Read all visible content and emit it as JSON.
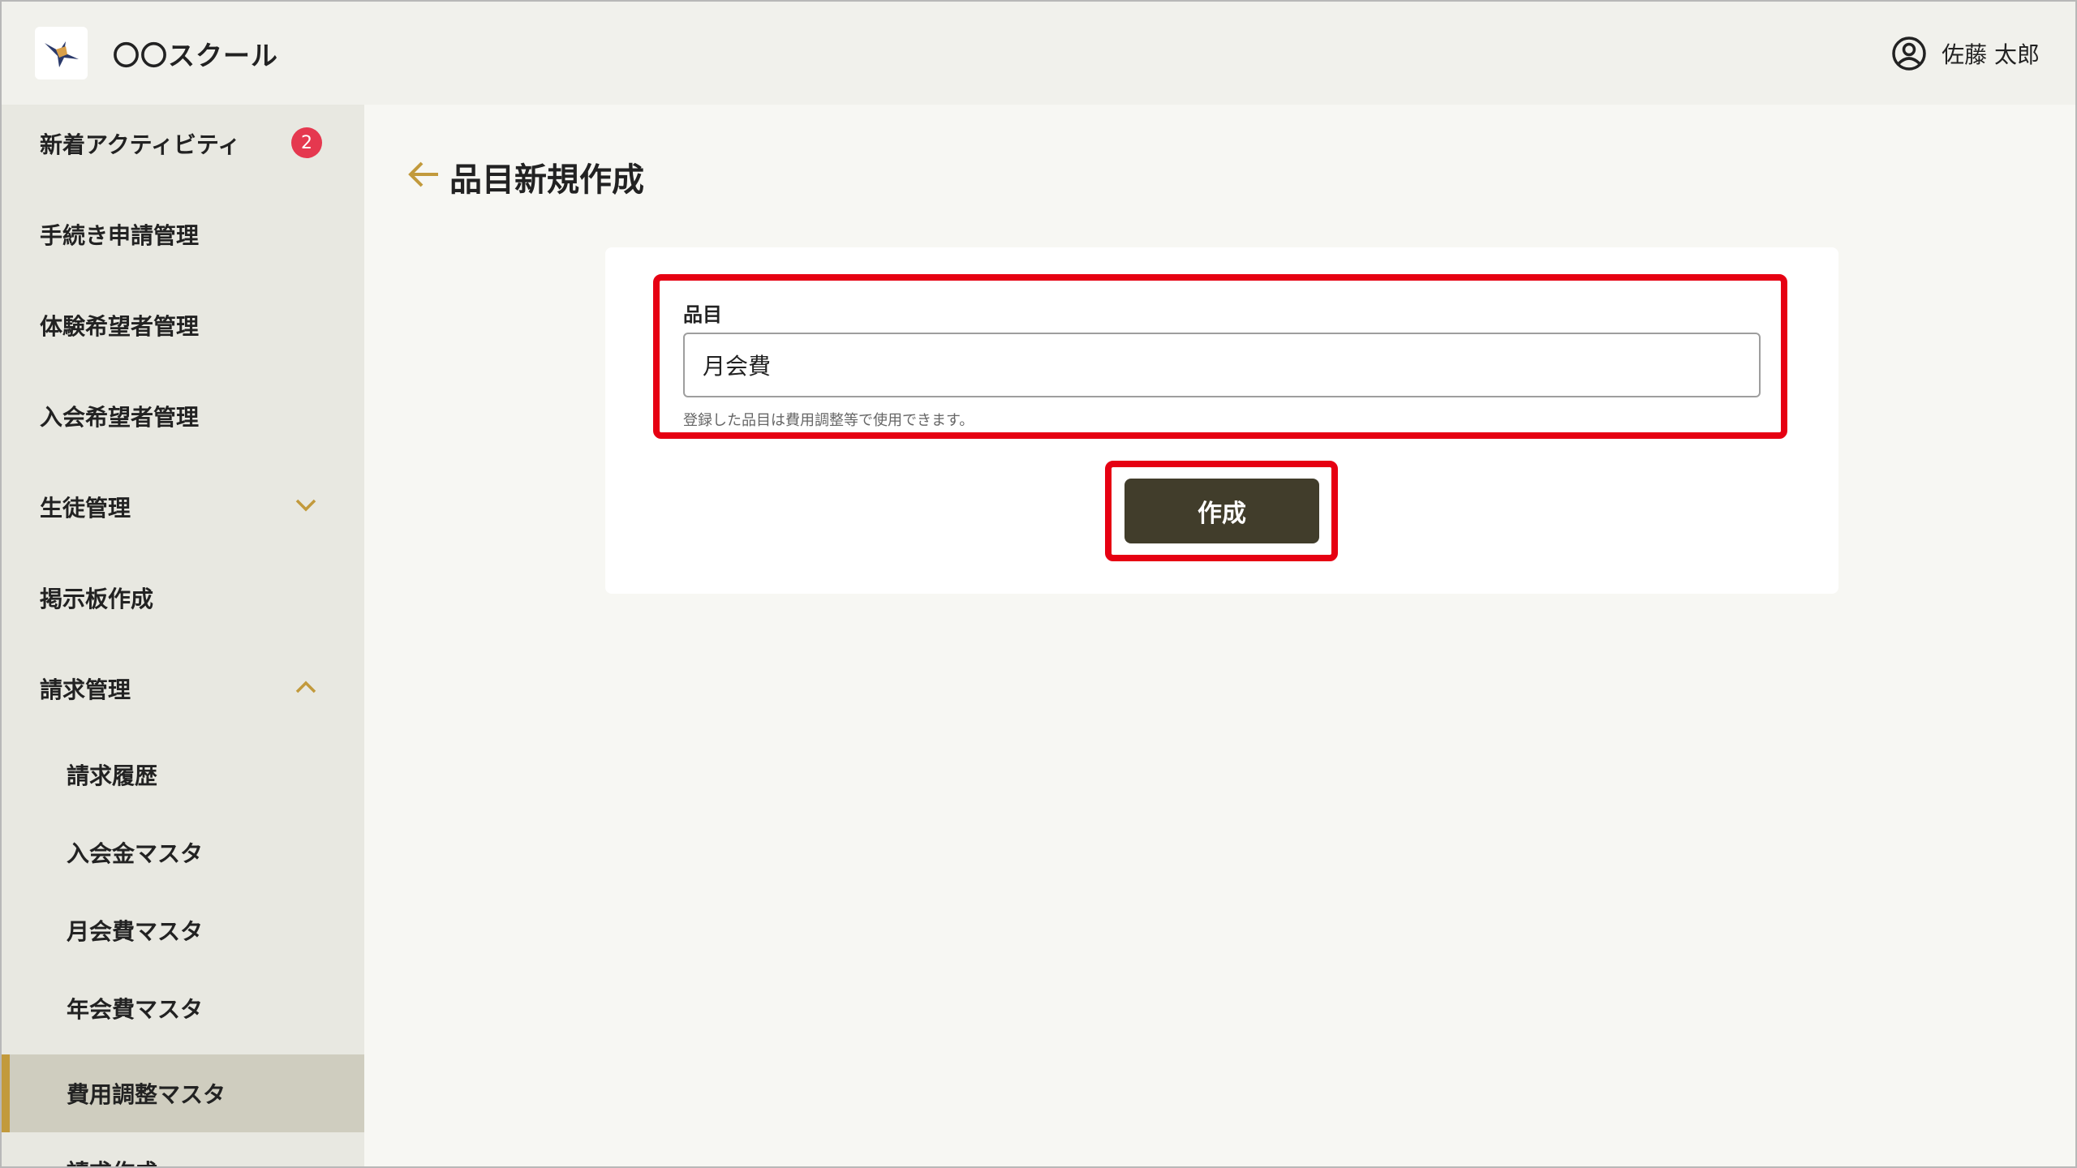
{
  "header": {
    "app_title": "〇〇スクール",
    "user_name": "佐藤 太郎"
  },
  "sidebar": {
    "items": [
      {
        "label": "新着アクティビティ",
        "badge": "2"
      },
      {
        "label": "手続き申請管理"
      },
      {
        "label": "体験希望者管理"
      },
      {
        "label": "入会希望者管理"
      },
      {
        "label": "生徒管理",
        "expanded": false
      },
      {
        "label": "掲示板作成"
      },
      {
        "label": "請求管理",
        "expanded": true
      }
    ],
    "billing_subitems": [
      {
        "label": "請求履歴"
      },
      {
        "label": "入会金マスタ"
      },
      {
        "label": "月会費マスタ"
      },
      {
        "label": "年会費マスタ"
      },
      {
        "label": "費用調整マスタ",
        "active": true
      },
      {
        "label": "請求作成"
      }
    ]
  },
  "main": {
    "page_title": "品目新規作成",
    "form": {
      "field_label": "品目",
      "field_value": "月会費",
      "help_text": "登録した品目は費用調整等で使用できます。",
      "submit_label": "作成"
    }
  },
  "colors": {
    "accent": "#c29a3c",
    "badge": "#e5384f",
    "button": "#413d2b",
    "highlight": "#e60012",
    "sidebar_active": "#cfcdbf"
  }
}
